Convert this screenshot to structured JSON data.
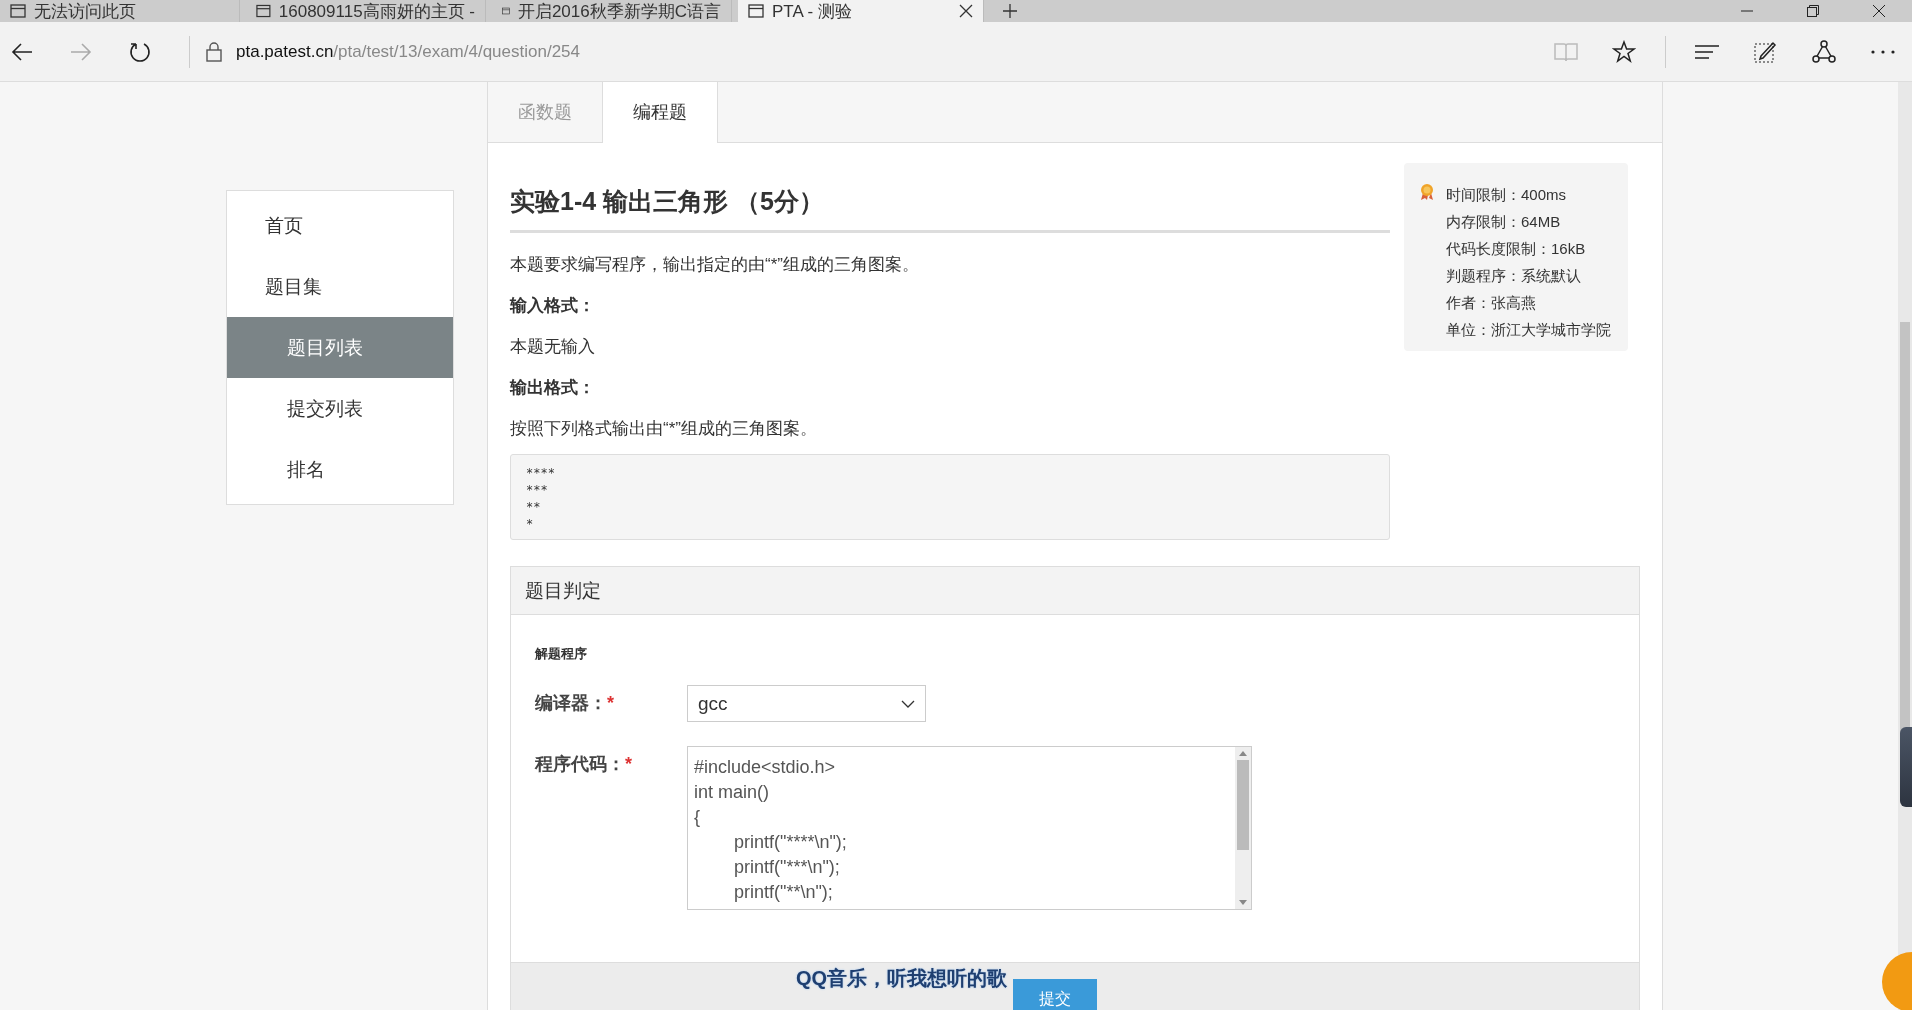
{
  "browser": {
    "tabs": [
      {
        "title": "无法访问此页",
        "selected": false
      },
      {
        "title": "160809115高雨妍的主页 -",
        "selected": false
      },
      {
        "title": "开启2016秋季新学期C语言",
        "selected": false
      },
      {
        "title": "PTA - 测验",
        "selected": true
      }
    ],
    "address": {
      "host": "pta.patest.cn",
      "path": "/pta/test/13/exam/4/question/254"
    }
  },
  "sidebar": {
    "items": [
      {
        "label": "首页",
        "selected": false
      },
      {
        "label": "题目集",
        "selected": false,
        "children": [
          {
            "label": "题目列表",
            "selected": true
          },
          {
            "label": "提交列表",
            "selected": false
          },
          {
            "label": "排名",
            "selected": false
          }
        ]
      }
    ]
  },
  "question_tabs": [
    {
      "label": "函数题",
      "selected": false
    },
    {
      "label": "编程题",
      "selected": true
    }
  ],
  "problem": {
    "title": "实验1-4 输出三角形 （5分）",
    "paragraphs": [
      {
        "kind": "text",
        "text": "本题要求编写程序，输出指定的由“*”组成的三角图案。"
      },
      {
        "kind": "heading",
        "text": "输入格式："
      },
      {
        "kind": "text",
        "text": "本题无输入"
      },
      {
        "kind": "heading",
        "text": "输出格式："
      },
      {
        "kind": "text",
        "text": "按照下列格式输出由“*”组成的三角图案。"
      },
      {
        "kind": "code",
        "lines": [
          "****",
          "***",
          "**",
          "*"
        ]
      }
    ],
    "info": [
      "时间限制：400ms",
      "内存限制：64MB",
      "代码长度限制：16kB",
      "判题程序：系统默认",
      "作者：张高燕",
      "单位：浙江大学城市学院"
    ]
  },
  "judge": {
    "header": "题目判定",
    "section": "解题程序",
    "compiler": {
      "label": "编译器：",
      "required": "*",
      "value": "gcc"
    },
    "code": {
      "label": "程序代码：",
      "required": "*",
      "lines": [
        "#include<stdio.h>",
        "int main()",
        "{",
        "\tprintf(\"****\\n\");",
        "\tprintf(\"***\\n\");",
        "\tprintf(\"**\\n\");"
      ]
    },
    "submit": "提交"
  },
  "overlay_lyric": "QQ音乐，听我想听的歌"
}
